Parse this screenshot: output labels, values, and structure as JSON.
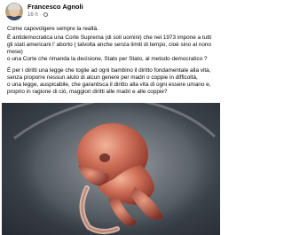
{
  "post": {
    "author_name": "Francesco Agnoli",
    "timestamp": "16 h",
    "separator": "·",
    "paragraphs": [
      "Come capovolgere sempre la realtà.",
      "È antidemocratica una Corte Suprema (di soli uomini) che nel 1973 impone a tutti gli stati americani l' aborto ( talvolta anche senza limiti di tempo, cioè sino al nono mese)",
      "o una Corte che rimanda la decisione, Stato per Stato, al metodo democratico ?",
      "È per i diritti una legge che toglie ad ogni bambino il diritto fondamentale alla vita, senza proporre nessun aiuto di alcun genere per madri o coppie in difficoltà,",
      "o una legge, auspicabile,  che garantisca il diritto alla vita di ogni essere umano e, proprio in ragione di ciò, maggiori diritti alle madri e alle coppie?"
    ],
    "image_subject": "human fetus in the womb"
  },
  "icons": {
    "privacy": "globe-icon"
  }
}
